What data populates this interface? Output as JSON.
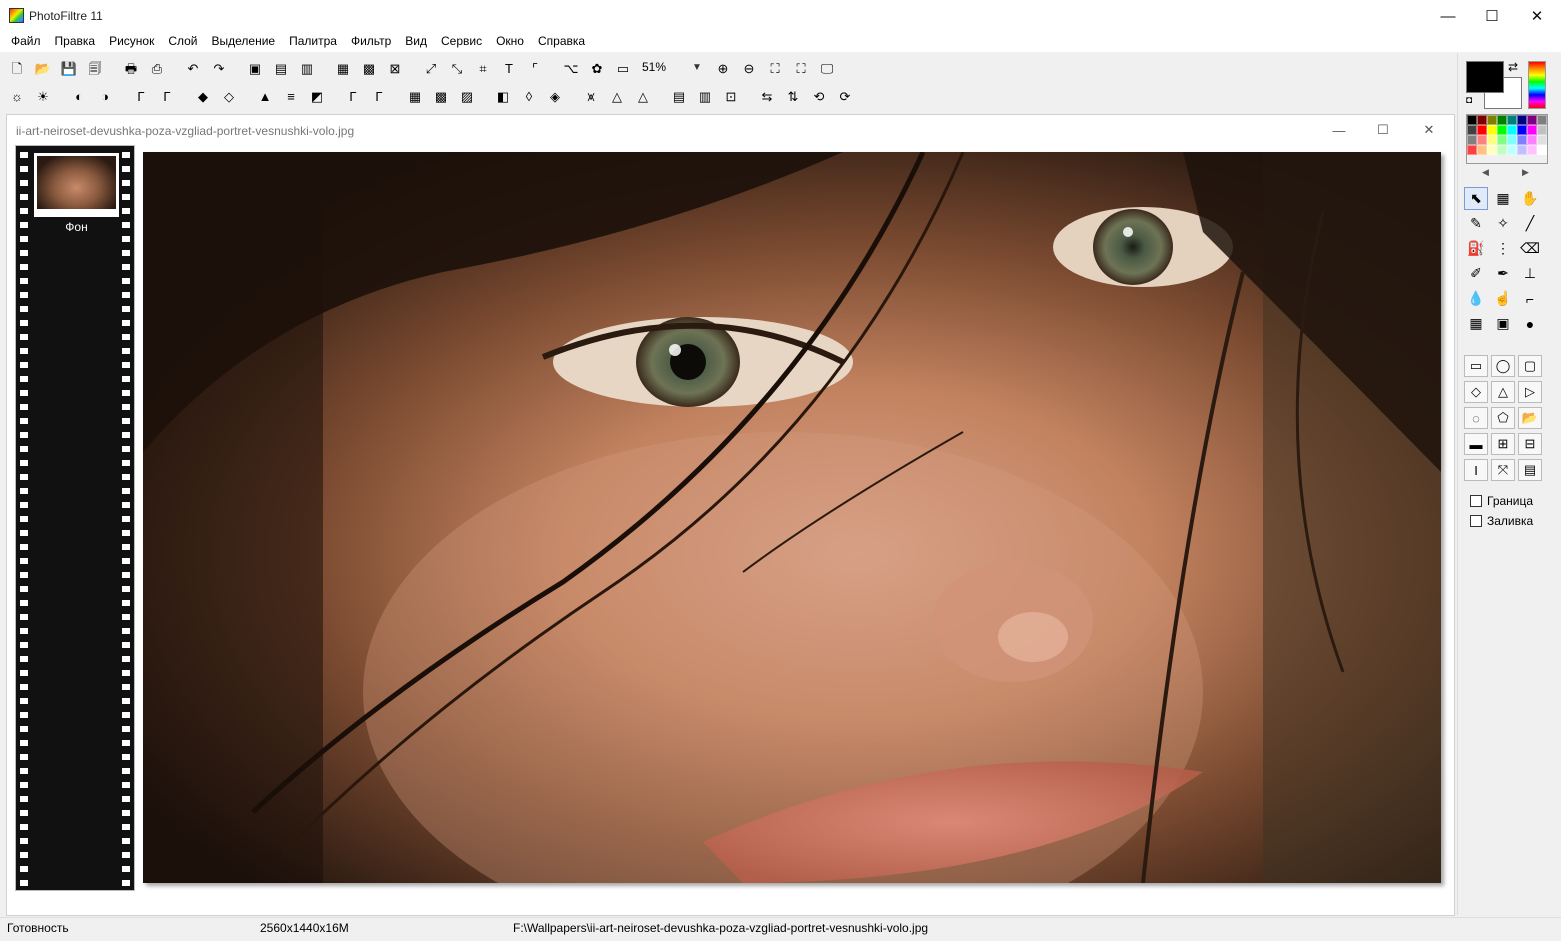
{
  "app": {
    "title": "PhotoFiltre 11"
  },
  "window_controls": {
    "minimize": "—",
    "maximize": "☐",
    "close": "✕"
  },
  "menu": [
    "Файл",
    "Правка",
    "Рисунок",
    "Слой",
    "Выделение",
    "Палитра",
    "Фильтр",
    "Вид",
    "Сервис",
    "Окно",
    "Справка"
  ],
  "toolbar": {
    "row1": [
      {
        "name": "new-icon",
        "glyph": "🗋"
      },
      {
        "name": "open-icon",
        "glyph": "📂"
      },
      {
        "name": "save-icon",
        "glyph": "💾"
      },
      {
        "name": "save-all-icon",
        "glyph": "🗐"
      },
      {
        "name": "sep"
      },
      {
        "name": "print-icon",
        "glyph": "🖶"
      },
      {
        "name": "scan-icon",
        "glyph": "⎙"
      },
      {
        "name": "sep"
      },
      {
        "name": "undo-icon",
        "glyph": "↶"
      },
      {
        "name": "redo-icon",
        "glyph": "↷"
      },
      {
        "name": "sep"
      },
      {
        "name": "paste-image-icon",
        "glyph": "▣"
      },
      {
        "name": "copy-image-icon",
        "glyph": "▤"
      },
      {
        "name": "paste-as-icon",
        "glyph": "▥"
      },
      {
        "name": "sep"
      },
      {
        "name": "transparency-icon",
        "glyph": "▦"
      },
      {
        "name": "color-mode-icon",
        "glyph": "▩"
      },
      {
        "name": "exif-icon",
        "glyph": "⊠"
      },
      {
        "name": "sep"
      },
      {
        "name": "image-size-icon",
        "glyph": "⤢"
      },
      {
        "name": "canvas-size-icon",
        "glyph": "⤡"
      },
      {
        "name": "crop-icon",
        "glyph": "⌗"
      },
      {
        "name": "text-icon",
        "glyph": "T"
      },
      {
        "name": "frame-icon",
        "glyph": "⌜"
      },
      {
        "name": "sep"
      },
      {
        "name": "explorer-icon",
        "glyph": "⌥"
      },
      {
        "name": "plugins-icon",
        "glyph": "✿"
      },
      {
        "name": "screen-capture-icon",
        "glyph": "▭"
      }
    ],
    "row1b": [
      {
        "name": "zoom-in-icon",
        "glyph": "⊕"
      },
      {
        "name": "zoom-out-icon",
        "glyph": "⊖"
      },
      {
        "name": "actual-size-icon",
        "glyph": "⛶"
      },
      {
        "name": "fit-window-icon",
        "glyph": "⛶"
      },
      {
        "name": "full-screen-icon",
        "glyph": "🖵"
      }
    ],
    "row2": [
      {
        "name": "brightness-up-icon",
        "glyph": "☼"
      },
      {
        "name": "brightness-down-icon",
        "glyph": "☀"
      },
      {
        "name": "sep"
      },
      {
        "name": "contrast-up-icon",
        "glyph": "◐"
      },
      {
        "name": "contrast-down-icon",
        "glyph": "◑"
      },
      {
        "name": "sep"
      },
      {
        "name": "gamma-up-icon",
        "glyph": "Γ"
      },
      {
        "name": "gamma-down-icon",
        "glyph": "Γ"
      },
      {
        "name": "sep"
      },
      {
        "name": "saturation-up-icon",
        "glyph": "◆"
      },
      {
        "name": "saturation-down-icon",
        "glyph": "◇"
      },
      {
        "name": "sep"
      },
      {
        "name": "levels-icon",
        "glyph": "▲"
      },
      {
        "name": "color-balance-icon",
        "glyph": "≡"
      },
      {
        "name": "grayscale-icon",
        "glyph": "◩"
      },
      {
        "name": "sep"
      },
      {
        "name": "auto-levels-icon",
        "glyph": "Γ"
      },
      {
        "name": "auto-contrast-icon",
        "glyph": "Γ"
      },
      {
        "name": "sep"
      },
      {
        "name": "dither-icon",
        "glyph": "▦"
      },
      {
        "name": "mosaic-icon",
        "glyph": "▩"
      },
      {
        "name": "pattern-icon",
        "glyph": "▨"
      },
      {
        "name": "sep"
      },
      {
        "name": "blur-icon",
        "glyph": "◧"
      },
      {
        "name": "soften-icon",
        "glyph": "◊"
      },
      {
        "name": "sharpen-icon",
        "glyph": "◈"
      },
      {
        "name": "sep"
      },
      {
        "name": "emboss-icon",
        "glyph": "⩙"
      },
      {
        "name": "triangle-icon",
        "glyph": "△"
      },
      {
        "name": "triangle-outline-icon",
        "glyph": "△"
      },
      {
        "name": "sep"
      },
      {
        "name": "gradient-icon",
        "glyph": "▤"
      },
      {
        "name": "fade-icon",
        "glyph": "▥"
      },
      {
        "name": "texture-icon",
        "glyph": "⊡"
      },
      {
        "name": "sep"
      },
      {
        "name": "flip-h-icon",
        "glyph": "⇆"
      },
      {
        "name": "flip-v-icon",
        "glyph": "⇅"
      },
      {
        "name": "rotate-left-icon",
        "glyph": "⟲"
      },
      {
        "name": "rotate-right-icon",
        "glyph": "⟳"
      }
    ],
    "zoom": "51%"
  },
  "document": {
    "title": "ii-art-neiroset-devushka-poza-vzgliad-portret-vesnushki-volo.jpg",
    "layer_name": "Фон"
  },
  "right_panel": {
    "palette": [
      "#000000",
      "#7f0000",
      "#7f7f00",
      "#007f00",
      "#007f7f",
      "#00007f",
      "#7f007f",
      "#7f7f7f",
      "#404040",
      "#ff0000",
      "#ffff00",
      "#00ff00",
      "#00ffff",
      "#0000ff",
      "#ff00ff",
      "#c0c0c0",
      "#808080",
      "#ff8080",
      "#ffff80",
      "#80ff80",
      "#80ffff",
      "#8080ff",
      "#ff80ff",
      "#e0e0e0",
      "#ff4040",
      "#ffc080",
      "#ffffc0",
      "#c0ffc0",
      "#c0ffff",
      "#c0c0ff",
      "#ffc0ff",
      "#ffffff"
    ],
    "tools": [
      {
        "name": "select-tool-icon",
        "glyph": "⬉",
        "active": true
      },
      {
        "name": "magic-select-tool-icon",
        "glyph": "▦"
      },
      {
        "name": "hand-tool-icon",
        "glyph": "✋"
      },
      {
        "name": "eyedropper-tool-icon",
        "glyph": "✎"
      },
      {
        "name": "magic-wand-tool-icon",
        "glyph": "✧"
      },
      {
        "name": "line-tool-icon",
        "glyph": "╱"
      },
      {
        "name": "fill-tool-icon",
        "glyph": "⛽"
      },
      {
        "name": "spray-tool-icon",
        "glyph": "⋮"
      },
      {
        "name": "eraser-tool-icon",
        "glyph": "⌫"
      },
      {
        "name": "brush-tool-icon",
        "glyph": "✐"
      },
      {
        "name": "advanced-brush-tool-icon",
        "glyph": "✒"
      },
      {
        "name": "stamp-tool-icon",
        "glyph": "⊥"
      },
      {
        "name": "blur-tool-icon",
        "glyph": "💧"
      },
      {
        "name": "smudge-tool-icon",
        "glyph": "☝"
      },
      {
        "name": "clone-tool-icon",
        "glyph": "⌐"
      },
      {
        "name": "deform-tool-icon",
        "glyph": "▦"
      },
      {
        "name": "image-tube-tool-icon",
        "glyph": "▣"
      },
      {
        "name": "red-eye-tool-icon",
        "glyph": "●"
      }
    ],
    "shapes": [
      {
        "name": "rectangle-shape-icon",
        "glyph": "▭"
      },
      {
        "name": "ellipse-shape-icon",
        "glyph": "◯"
      },
      {
        "name": "rounded-rect-shape-icon",
        "glyph": "▢"
      },
      {
        "name": "diamond-shape-icon",
        "glyph": "◇"
      },
      {
        "name": "triangle-shape-icon",
        "glyph": "△"
      },
      {
        "name": "right-triangle-shape-icon",
        "glyph": "▷"
      },
      {
        "name": "lasso-shape-icon",
        "glyph": "◌"
      },
      {
        "name": "polygon-shape-icon",
        "glyph": "⬠"
      },
      {
        "name": "load-shape-icon",
        "glyph": "📂"
      },
      {
        "name": "align-h-icon",
        "glyph": "▬"
      },
      {
        "name": "center-h-icon",
        "glyph": "⊞"
      },
      {
        "name": "center-v-icon",
        "glyph": "⊟"
      },
      {
        "name": "text-shape-icon",
        "glyph": "I"
      },
      {
        "name": "resize-shape-icon",
        "glyph": "⤧"
      },
      {
        "name": "shape-settings-icon",
        "glyph": "▤"
      }
    ],
    "options": [
      "Граница",
      "Заливка"
    ]
  },
  "status": {
    "ready": "Готовность",
    "image_info": "2560x1440x16M",
    "path": "F:\\Wallpapers\\ii-art-neiroset-devushka-poza-vzgliad-portret-vesnushki-volo.jpg"
  }
}
